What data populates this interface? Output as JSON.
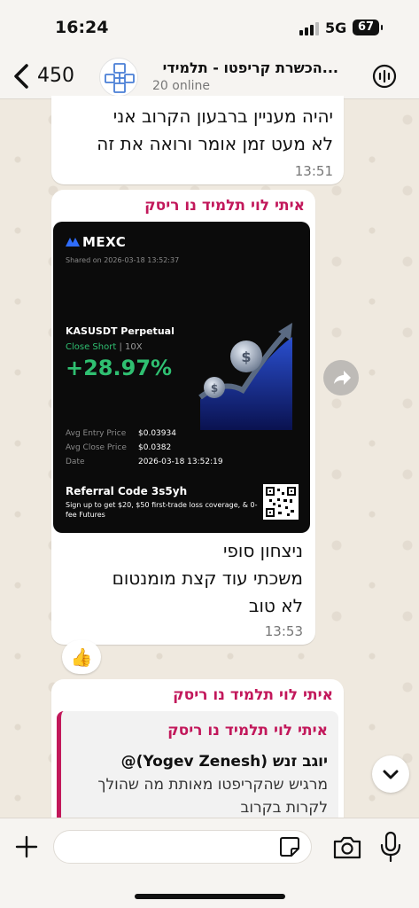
{
  "status_bar": {
    "time": "16:24",
    "network": "5G",
    "battery": "67"
  },
  "header": {
    "back_count": "450",
    "title": "הכשרת קריפטו - תלמידי...",
    "subtitle": "20 online"
  },
  "messages": [
    {
      "text_lines": [
        "יהיה מעניין ברבעון הקרוב אני",
        "לא מעט זמן אומר ורואה את זה"
      ],
      "time": "13:51"
    },
    {
      "sender": "איתי לוי תלמיד נו ריסק",
      "card": {
        "brand": "MEXC",
        "shared": "Shared on 2026-03-18 13:52:37",
        "pair": "KASUSDT Perpetual",
        "side": "Close Short",
        "leverage": "10X",
        "pnl": "+28.97%",
        "avg_entry_label": "Avg Entry Price",
        "avg_entry_value": "$0.03934",
        "avg_close_label": "Avg Close Price",
        "avg_close_value": "$0.0382",
        "date_label": "Date",
        "date_value": "2026-03-18 13:52:19",
        "referral": "Referral Code 3s5yh",
        "referral_desc": "Sign up to get $20, $50 first-trade loss coverage, & 0-fee Futures"
      },
      "text_lines": [
        "ניצחון סופי",
        "משכתי עוד קצת מומנטום",
        "לא טוב"
      ],
      "time": "13:53",
      "reaction": "👍"
    },
    {
      "sender": "איתי לוי תלמיד נו ריסק",
      "quote": {
        "sender": "איתי לוי תלמיד נו ריסק",
        "mention": "יוגב זנש (Yogev Zenesh)@",
        "lines": [
          "מרגיש שהקריפטו מאותת מה שהולך",
          "לקרות בקרוב"
        ]
      }
    }
  ],
  "input": {
    "placeholder": ""
  },
  "colors": {
    "sender": "#c2185b",
    "profit": "#2fbf71",
    "background": "#efeae2"
  }
}
